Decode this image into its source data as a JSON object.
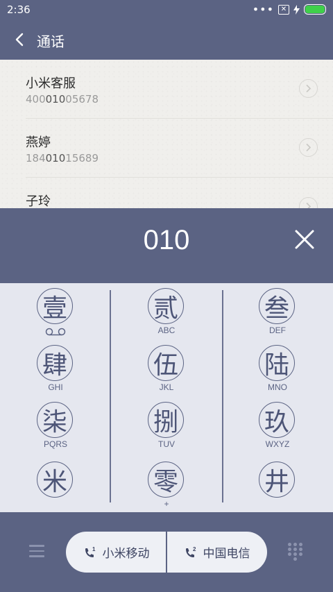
{
  "status_bar": {
    "time": "2:36",
    "dots": "•••",
    "sim_icon": "sim-x-icon",
    "charging_icon": "bolt-icon",
    "battery_color": "#3fd04a"
  },
  "app_bar": {
    "back_icon": "chevron-left-icon",
    "title": "通话"
  },
  "contacts": [
    {
      "name": "小米客服",
      "number_pre": "400",
      "number_match": "010",
      "number_post": "05678"
    },
    {
      "name": "燕婷",
      "number_pre": "184",
      "number_match": "010",
      "number_post": "15689"
    },
    {
      "name": "子玲",
      "number_pre": "",
      "number_match": "",
      "number_post": ""
    }
  ],
  "dial": {
    "digits": "010",
    "clear_icon": "close-icon"
  },
  "keypad": [
    {
      "glyph": "壹",
      "letters": ""
    },
    {
      "glyph": "贰",
      "letters": "ABC"
    },
    {
      "glyph": "叁",
      "letters": "DEF"
    },
    {
      "glyph": "肆",
      "letters": "GHI"
    },
    {
      "glyph": "伍",
      "letters": "JKL"
    },
    {
      "glyph": "陆",
      "letters": "MNO"
    },
    {
      "glyph": "柒",
      "letters": "PQRS"
    },
    {
      "glyph": "捌",
      "letters": "TUV"
    },
    {
      "glyph": "玖",
      "letters": "WXYZ"
    },
    {
      "glyph": "米",
      "letters": ""
    },
    {
      "glyph": "零",
      "letters": "+"
    },
    {
      "glyph": "井",
      "letters": ""
    }
  ],
  "bottom": {
    "sim1_label": "小米移动",
    "sim1_badge": "1",
    "sim2_label": "中国电信",
    "sim2_badge": "2",
    "menu_icon": "menu-icon",
    "dialpad_icon": "dialpad-icon"
  },
  "colors": {
    "theme": "#5b6383",
    "keypad_bg": "#e5e7ef",
    "list_bg": "#f0efec"
  }
}
